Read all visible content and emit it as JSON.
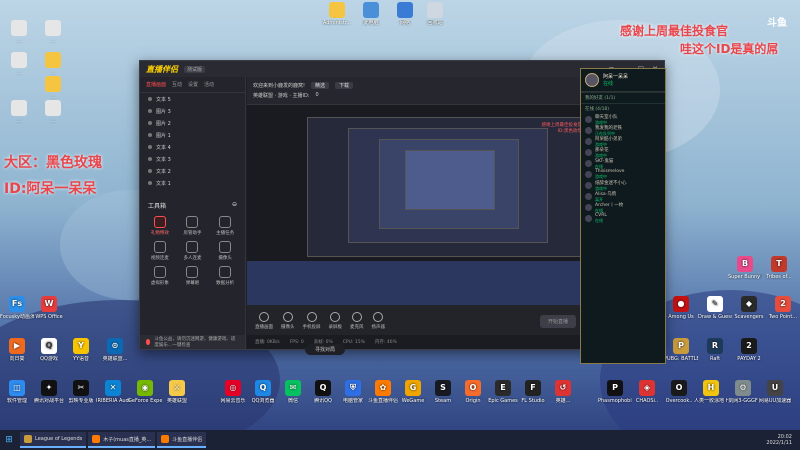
{
  "overlay": {
    "thanks_line1": "感谢上周最佳投食官",
    "thanks_line2": "哇这个ID是真的屌",
    "big_line1": "大区：黑色玫瑰",
    "big_line2": "ID:阿呆一呆呆",
    "watermark": "斗鱼"
  },
  "desktop_top_icons": [
    {
      "label": "Administr...",
      "color": "#f5c542",
      "icon": "folder-icon"
    },
    {
      "label": "此电脑",
      "color": "#4a90d9",
      "icon": "computer-icon"
    },
    {
      "label": "网络",
      "color": "#3a7bd5",
      "icon": "network-icon"
    },
    {
      "label": "回收站",
      "color": "#cfd8e0",
      "icon": "recycle-bin-icon"
    }
  ],
  "desktop_left_icons": [
    {
      "label": "...",
      "color": "#e6e6e6",
      "icon": "document-icon"
    },
    {
      "label": "...",
      "color": "#e6e6e6",
      "icon": "document-icon"
    },
    {
      "label": "...",
      "color": "#e6e6e6",
      "icon": "document-icon"
    },
    {
      "label": "...",
      "color": "#f5c542",
      "icon": "folder-icon"
    },
    {
      "label": "...",
      "color": "#f5c542",
      "icon": "folder-icon"
    },
    {
      "label": "...",
      "color": "#e6e6e6",
      "icon": "document-icon"
    },
    {
      "label": "...",
      "color": "#e6e6e6",
      "icon": "document-icon"
    }
  ],
  "desktop_left_apps": [
    {
      "label": "Focusky动画演示大师",
      "color": "#2c8ee8",
      "glyph": "Fs"
    },
    {
      "label": "WPS Office",
      "color": "#e83c3c",
      "glyph": "W"
    },
    {
      "label": "向日葵",
      "color": "#f06a1e",
      "glyph": "▶"
    },
    {
      "label": "QQ游戏",
      "color": "#ffffff",
      "glyph": "Q"
    },
    {
      "label": "YY语音",
      "color": "#f8c300",
      "glyph": "Y"
    },
    {
      "label": "英雄联盟...",
      "color": "#0a6ab5",
      "glyph": "⊙"
    }
  ],
  "desktop_right_icons": [
    {
      "label": "Among Us",
      "color": "#c51111",
      "glyph": "●"
    },
    {
      "label": "Draw & Guess",
      "color": "#ffffff",
      "glyph": "✎"
    },
    {
      "label": "Scavengers",
      "color": "#2a2a2a",
      "glyph": "◆"
    },
    {
      "label": "PUBG: BATTLEGR...",
      "color": "#c89b3c",
      "glyph": "P"
    },
    {
      "label": "Raft",
      "color": "#1e3a5a",
      "glyph": "R"
    },
    {
      "label": "PAYDAY 2",
      "color": "#1a1a1a",
      "glyph": "2"
    },
    {
      "label": "Super Bunny Man",
      "color": "#e84a8a",
      "glyph": "B"
    },
    {
      "label": "Tribes of...",
      "color": "#c0392b",
      "glyph": "T"
    },
    {
      "label": "Two Point...",
      "color": "#e74c3c",
      "glyph": "2"
    }
  ],
  "launch_icons": [
    {
      "label": "软件管理",
      "color": "#2d8cf0",
      "glyph": "◫"
    },
    {
      "label": "腾讯对战平台",
      "color": "#111111",
      "glyph": "✦"
    },
    {
      "label": "剪映专业版",
      "color": "#111111",
      "glyph": "✂"
    },
    {
      "label": "IRIBERIA Audio...",
      "color": "#0b84d4",
      "glyph": "✕"
    },
    {
      "label": "GeForce Experience",
      "color": "#76b900",
      "glyph": "◉"
    },
    {
      "label": "英雄联盟",
      "color": "#f7c948",
      "glyph": "⚔"
    },
    {
      "label": "网易云音乐",
      "color": "#e60026",
      "glyph": "◎"
    },
    {
      "label": "QQ浏览器",
      "color": "#1e88e5",
      "glyph": "Q"
    },
    {
      "label": "微信",
      "color": "#07c160",
      "glyph": "✉"
    },
    {
      "label": "腾讯QQ",
      "color": "#111111",
      "glyph": "Q"
    },
    {
      "label": "电脑管家",
      "color": "#2f6fe6",
      "glyph": "⛨"
    },
    {
      "label": "斗鱼直播伴侣",
      "color": "#ff7a00",
      "glyph": "✿"
    },
    {
      "label": "WeGame",
      "color": "#f0a500",
      "glyph": "G"
    },
    {
      "label": "Steam",
      "color": "#171a21",
      "glyph": "S"
    },
    {
      "label": "Origin",
      "color": "#f56c2d",
      "glyph": "O"
    },
    {
      "label": "Epic Games",
      "color": "#2a2a2a",
      "glyph": "E"
    },
    {
      "label": "FL Studio",
      "color": "#222222",
      "glyph": "F"
    },
    {
      "label": "英雄...",
      "color": "#dd3333",
      "glyph": "↺"
    },
    {
      "label": "Phasmophobia",
      "color": "#111111",
      "glyph": "P"
    },
    {
      "label": "CHAOSi..",
      "color": "#dd3333",
      "glyph": "◈"
    },
    {
      "label": "Overcook..",
      "color": "#1a1a1a",
      "glyph": "O"
    },
    {
      "label": "人类一败涂地 Human Fa..",
      "color": "#f1c40f",
      "glyph": "H"
    },
    {
      "label": "剑网3-GGGF",
      "color": "#7f8c8d",
      "glyph": "⚙"
    },
    {
      "label": "网易UU加速器",
      "color": "#444444",
      "glyph": "U"
    }
  ],
  "app": {
    "logo": "直播伴侣",
    "version": "测试版",
    "tabs": [
      "直播画面",
      "互动",
      "设置",
      "活动"
    ],
    "scenes": [
      "文本 5",
      "图片 3",
      "图片 2",
      "图片 1",
      "文本 4",
      "文本 3",
      "文本 2",
      "文本 1"
    ],
    "tools_title": "工具箱",
    "tools": [
      {
        "label": "礼物特效",
        "red": true
      },
      {
        "label": "房管助手",
        "red": false
      },
      {
        "label": "主播任务",
        "red": false
      },
      {
        "label": "视频连麦",
        "red": false
      },
      {
        "label": "多人连麦",
        "red": false
      },
      {
        "label": "摄像头",
        "red": false
      },
      {
        "label": "虚拟形象",
        "red": false
      },
      {
        "label": "弹幕姬",
        "red": false
      },
      {
        "label": "数据分析",
        "red": false
      }
    ],
    "notice": "斗鱼公益，请勿沉迷网游，健康游戏、适度娱乐…一键检查",
    "header_line1": "欢迎来到小鹿发的鹿窝!",
    "header_tag": "精选",
    "header_btn": "下载",
    "header_line2": "英雄联盟 · 游戏 · 主播ID:",
    "header_fans": "0",
    "preview_text1": "感谢上周最佳投食官",
    "preview_text2": "ID:黑色玫瑰",
    "bottom_items": [
      "直播画面",
      "摄像头",
      "手机投屏",
      "录屏板",
      "麦克风",
      "扬声器"
    ],
    "go_live": "开始直播",
    "status": [
      "直播: 0KB/s",
      "FPS: 0",
      "丢帧: 0%",
      "CPU: 15%",
      "内存: 46%"
    ],
    "find_host": "寻找对局"
  },
  "chat": {
    "user": "阿呆一呆呆",
    "status": "在线",
    "group1": "我的好友 (1/1)",
    "group2": "在线 (4/18)",
    "friends": [
      {
        "name": "聊天室小队",
        "state": "游戏中"
      },
      {
        "name": "我发我的老铁",
        "state": "正在队列中"
      },
      {
        "name": "阿呆酷小弟弟",
        "state": "游戏中"
      },
      {
        "name": "那朵花",
        "state": "游戏中"
      },
      {
        "name": "SKT-鬼猫",
        "state": "在线"
      },
      {
        "name": "Thisismelove",
        "state": "游戏中"
      },
      {
        "name": "纸醉金迷不小心",
        "state": "游戏中"
      },
      {
        "name": "Alisa·乌鸦",
        "state": "离开"
      },
      {
        "name": "Archer丨一枚",
        "state": "在线"
      },
      {
        "name": "CVRL",
        "state": "在线"
      }
    ]
  },
  "taskbar": {
    "tasks": [
      {
        "label": "League of Legends",
        "color": "#c89b3c"
      },
      {
        "label": "木子(muas直播_英...",
        "color": "#ff7a00"
      },
      {
        "label": "斗鱼直播伴侣",
        "color": "#ff7a00"
      }
    ],
    "time": "20:02",
    "date": "2022/1/11"
  }
}
